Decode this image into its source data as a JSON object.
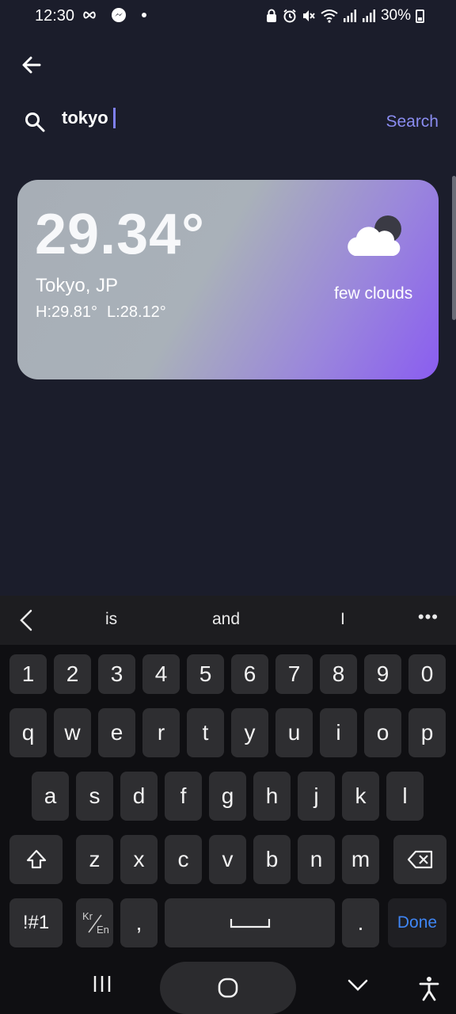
{
  "status_bar": {
    "time": "12:30",
    "battery": "30%",
    "icons": [
      "infinity-icon",
      "messenger-icon",
      "dot-icon",
      "lock-icon",
      "alarm-icon",
      "mute-icon",
      "wifi-icon",
      "signal-icon",
      "signal-icon",
      "battery-icon"
    ]
  },
  "search": {
    "query": "tokyo",
    "button_label": "Search"
  },
  "weather": {
    "temperature": "29.34°",
    "location": "Tokyo, JP",
    "high": "H:29.81°",
    "low": "L:28.12°",
    "condition": "few clouds",
    "icon": "few-clouds-icon"
  },
  "colors": {
    "background": "#1b1d2b",
    "accent": "#8a8cf0",
    "card_gradient_start": "#a7aeb6",
    "card_gradient_end": "#8a5df0",
    "keyboard_done": "#3f86f5"
  },
  "keyboard": {
    "suggestions": [
      "is",
      "and",
      "I"
    ],
    "number_row": [
      "1",
      "2",
      "3",
      "4",
      "5",
      "6",
      "7",
      "8",
      "9",
      "0"
    ],
    "row1": [
      "q",
      "w",
      "e",
      "r",
      "t",
      "y",
      "u",
      "i",
      "o",
      "p"
    ],
    "row2": [
      "a",
      "s",
      "d",
      "f",
      "g",
      "h",
      "j",
      "k",
      "l"
    ],
    "row3": [
      "z",
      "x",
      "c",
      "v",
      "b",
      "n",
      "m"
    ],
    "symbols_label": "!#1",
    "lang_kr": "Kr",
    "lang_en": "En",
    "comma": ",",
    "period": ".",
    "done_label": "Done"
  }
}
